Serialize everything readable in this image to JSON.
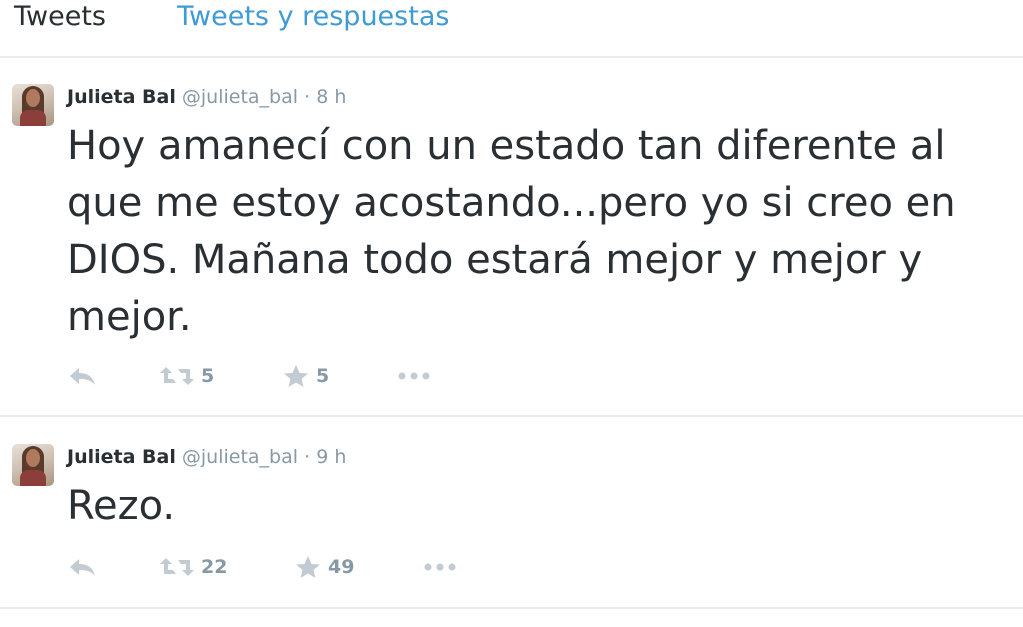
{
  "tabs": {
    "tweets": "Tweets",
    "tweets_and_replies": "Tweets y respuestas"
  },
  "colors": {
    "link": "#3e9bd3",
    "muted": "#8899a6",
    "text": "#292f33",
    "divider": "#e6ecf0"
  },
  "tweets": [
    {
      "name": "Julieta Bal",
      "handle": "@julieta_bal",
      "separator": "·",
      "time": "8 h",
      "text": "Hoy amanecí con un estado tan diferente al que me estoy acostando...pero yo si creo en DIOS. Mañana todo estará mejor y mejor y mejor.",
      "reply_icon": "reply-icon",
      "retweet_icon": "retweet-icon",
      "retweets": "5",
      "favorite_icon": "star-icon",
      "favorites": "5",
      "more_icon": "more-icon"
    },
    {
      "name": "Julieta Bal",
      "handle": "@julieta_bal",
      "separator": "·",
      "time": "9 h",
      "text": "Rezo.",
      "reply_icon": "reply-icon",
      "retweet_icon": "retweet-icon",
      "retweets": "22",
      "favorite_icon": "star-icon",
      "favorites": "49",
      "more_icon": "more-icon"
    }
  ]
}
